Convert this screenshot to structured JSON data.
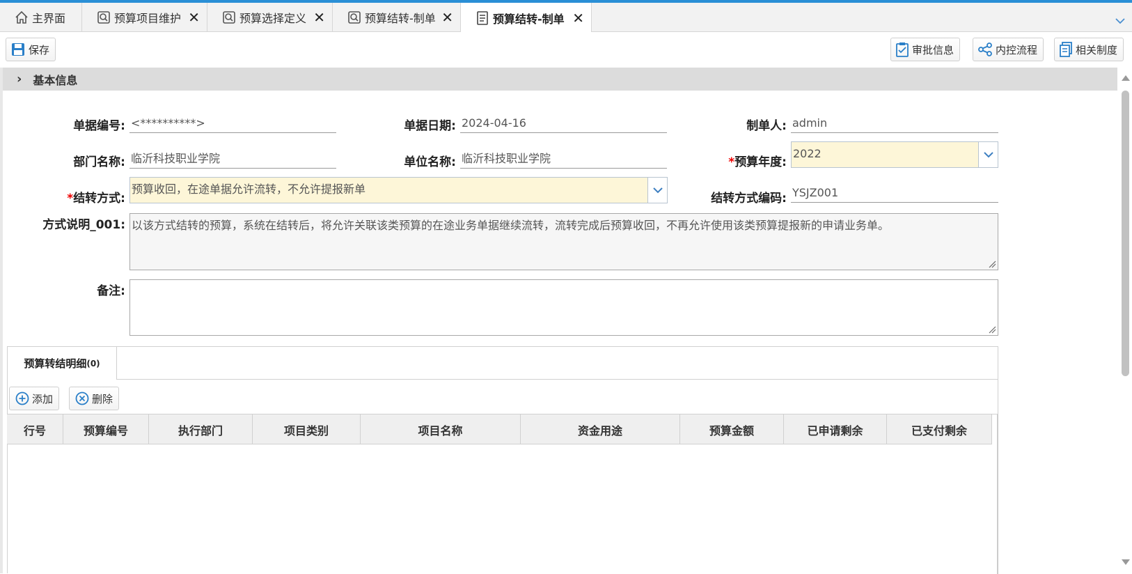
{
  "tabs": [
    {
      "label": "主界面",
      "icon": "home-icon"
    },
    {
      "label": "预算项目维护",
      "icon": "search-doc-icon"
    },
    {
      "label": "预算选择定义",
      "icon": "search-doc-icon"
    },
    {
      "label": "预算结转-制单",
      "icon": "search-doc-icon"
    },
    {
      "label": "预算结转-制单",
      "icon": "document-icon",
      "active": true
    }
  ],
  "toolbar": {
    "save_label": "保存",
    "approval_label": "审批信息",
    "control_flow_label": "内控流程",
    "related_rules_label": "相关制度"
  },
  "section": {
    "title": "基本信息"
  },
  "form": {
    "doc_no_label": "单据编号:",
    "doc_no_value": "<**********>",
    "doc_date_label": "单据日期:",
    "doc_date_value": "2024-04-16",
    "maker_label": "制单人:",
    "maker_value": "admin",
    "dept_label": "部门名称:",
    "dept_value": "临沂科技职业学院",
    "unit_label": "单位名称:",
    "unit_value": "临沂科技职业学院",
    "year_label": "预算年度:",
    "year_value": "2022",
    "method_label": "结转方式:",
    "method_value": "预算收回，在途单据允许流转，不允许提报新单",
    "method_code_label": "结转方式编码:",
    "method_code_value": "YSJZ001",
    "desc_label": "方式说明_001:",
    "desc_value": "以该方式结转的预算，系统在结转后，将允许关联该类预算的在途业务单据继续流转，流转完成后预算收回，不再允许使用该类预算提报新的申请业务单。",
    "remark_label": "备注:",
    "remark_value": ""
  },
  "detail": {
    "tab_label": "预算转结明细",
    "tab_count": "(0)",
    "add_label": "添加",
    "delete_label": "删除",
    "columns": [
      "行号",
      "预算编号",
      "执行部门",
      "项目类别",
      "项目名称",
      "资金用途",
      "预算金额",
      "已申请剩余",
      "已支付剩余"
    ]
  },
  "colors": {
    "accent": "#2a8fd6",
    "required": "#e00000",
    "highlight_field": "#fdf6d8"
  }
}
